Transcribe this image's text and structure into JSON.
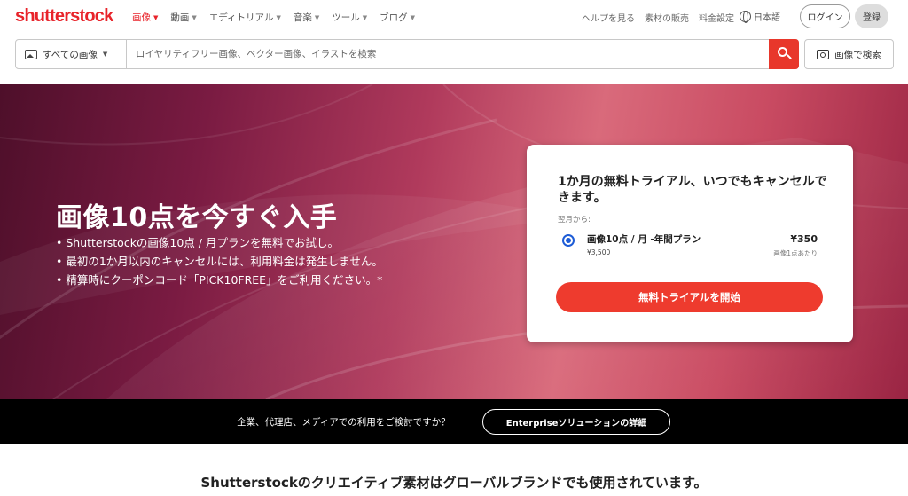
{
  "header": {
    "logo": "shutterstock",
    "nav": [
      {
        "label": "画像",
        "active": true
      },
      {
        "label": "動画",
        "active": false
      },
      {
        "label": "エディトリアル",
        "active": false
      },
      {
        "label": "音楽",
        "active": false
      },
      {
        "label": "ツール",
        "active": false
      },
      {
        "label": "ブログ",
        "active": false
      }
    ],
    "links": [
      "ヘルプを見る",
      "素材の販売",
      "料金設定"
    ],
    "language": "日本語",
    "login": "ログイン",
    "signup": "登録"
  },
  "search": {
    "type_label": "すべての画像",
    "placeholder": "ロイヤリティフリー画像、ベクター画像、イラストを検索",
    "image_search": "画像で検索"
  },
  "hero": {
    "title": "画像10点を今すぐ入手",
    "bullets": [
      "• Shutterstockの画像10点 / 月プランを無料でお試し。",
      "• 最初の1か月以内のキャンセルには、利用料金は発生しません。",
      "• 精算時にクーポンコード「PICK10FREE」をご利用ください。*"
    ]
  },
  "offer_card": {
    "title": "1か月の無料トライアル、いつでもキャンセルできます。",
    "subtitle": "翌月から:",
    "plan_name": "画像10点 / 月 -年間プラン",
    "plan_original": "¥3,500",
    "plan_price": "¥350",
    "plan_per": "画像1点あたり",
    "cta": "無料トライアルを開始"
  },
  "enterprise_bar": {
    "text": "企業、代理店、メディアでの利用をご検討ですか？",
    "button": "Enterpriseソリューションの詳細"
  },
  "bottom": {
    "title": "Shutterstockのクリエイティブ素材はグローバルブランドでも使用されています。"
  },
  "colors": {
    "brand_red": "#e8232a",
    "cta_red": "#ee3b2e",
    "radio_blue": "#1e5cd6"
  }
}
